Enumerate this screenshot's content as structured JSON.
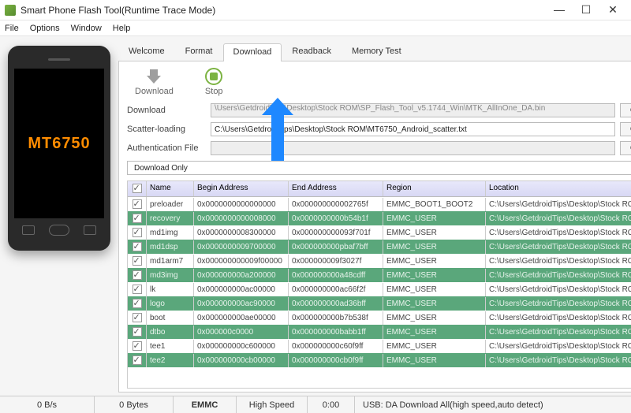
{
  "window": {
    "title": "Smart Phone Flash Tool(Runtime Trace Mode)"
  },
  "menu": {
    "file": "File",
    "options": "Options",
    "window": "Window",
    "help": "Help"
  },
  "phone": {
    "chip": "MT6750"
  },
  "tabs": [
    "Welcome",
    "Format",
    "Download",
    "Readback",
    "Memory Test"
  ],
  "activeTab": 2,
  "toolbar": {
    "download": "Download",
    "stop": "Stop"
  },
  "fields": {
    "downloadAgent": {
      "label": "Download",
      "value": "\\Users\\GetdroidTips\\Desktop\\Stock ROM\\SP_Flash_Tool_v5.1744_Win\\MTK_AllInOne_DA.bin"
    },
    "scatter": {
      "label": "Scatter-loading",
      "value": "C:\\Users\\GetdroidTips\\Desktop\\Stock ROM\\MT6750_Android_scatter.txt"
    },
    "auth": {
      "label": "Authentication File",
      "value": ""
    },
    "choose": "choose"
  },
  "mode": {
    "options": [
      "Download Only"
    ],
    "selected": "Download Only"
  },
  "table": {
    "headers": {
      "name": "Name",
      "begin": "Begin Address",
      "end": "End Address",
      "region": "Region",
      "location": "Location"
    },
    "rows": [
      {
        "checked": true,
        "name": "preloader",
        "begin": "0x0000000000000000",
        "end": "0x000000000002765f",
        "region": "EMMC_BOOT1_BOOT2",
        "location": "C:\\Users\\GetdroidTips\\Desktop\\Stock ROM\\pre..."
      },
      {
        "checked": true,
        "name": "recovery",
        "begin": "0x0000000000008000",
        "end": "0x0000000000b54b1f",
        "region": "EMMC_USER",
        "location": "C:\\Users\\GetdroidTips\\Desktop\\Stock ROM\\re..."
      },
      {
        "checked": true,
        "name": "md1img",
        "begin": "0x0000000008300000",
        "end": "0x000000000093f701f",
        "region": "EMMC_USER",
        "location": "C:\\Users\\GetdroidTips\\Desktop\\Stock ROM\\md..."
      },
      {
        "checked": true,
        "name": "md1dsp",
        "begin": "0x0000000009700000",
        "end": "0x000000000pbaf7bff",
        "region": "EMMC_USER",
        "location": "C:\\Users\\GetdroidTips\\Desktop\\Stock ROM\\md..."
      },
      {
        "checked": true,
        "name": "md1arm7",
        "begin": "0x000000000009f00000",
        "end": "0x000000009f3027f",
        "region": "EMMC_USER",
        "location": "C:\\Users\\GetdroidTips\\Desktop\\Stock ROM\\md..."
      },
      {
        "checked": true,
        "name": "md3img",
        "begin": "0x000000000a200000",
        "end": "0x000000000a48cdff",
        "region": "EMMC_USER",
        "location": "C:\\Users\\GetdroidTips\\Desktop\\Stock ROM\\md..."
      },
      {
        "checked": true,
        "name": "lk",
        "begin": "0x000000000ac00000",
        "end": "0x000000000ac66f2f",
        "region": "EMMC_USER",
        "location": "C:\\Users\\GetdroidTips\\Desktop\\Stock ROM\\lk.bin"
      },
      {
        "checked": true,
        "name": "logo",
        "begin": "0x000000000ac90000",
        "end": "0x000000000ad36bff",
        "region": "EMMC_USER",
        "location": "C:\\Users\\GetdroidTips\\Desktop\\Stock ROM\\lo..."
      },
      {
        "checked": true,
        "name": "boot",
        "begin": "0x000000000ae00000",
        "end": "0x000000000b7b538f",
        "region": "EMMC_USER",
        "location": "C:\\Users\\GetdroidTips\\Desktop\\Stock ROM\\bo..."
      },
      {
        "checked": true,
        "name": "dtbo",
        "begin": "0x000000c0000",
        "end": "0x000000000babb1ff",
        "region": "EMMC_USER",
        "location": "C:\\Users\\GetdroidTips\\Desktop\\Stock ROM\\dt..."
      },
      {
        "checked": true,
        "name": "tee1",
        "begin": "0x000000000c600000",
        "end": "0x000000000c60f9ff",
        "region": "EMMC_USER",
        "location": "C:\\Users\\GetdroidTips\\Desktop\\Stock ROM\\tru..."
      },
      {
        "checked": true,
        "name": "tee2",
        "begin": "0x000000000cb00000",
        "end": "0x000000000cb0f9ff",
        "region": "EMMC_USER",
        "location": "C:\\Users\\GetdroidTips\\Desktop\\Stock ROM\\tru..."
      }
    ]
  },
  "status": {
    "speed": "0 B/s",
    "bytes": "0 Bytes",
    "storage": "EMMC",
    "mode": "High Speed",
    "time": "0:00",
    "usb": "USB: DA Download All(high speed,auto detect)"
  }
}
